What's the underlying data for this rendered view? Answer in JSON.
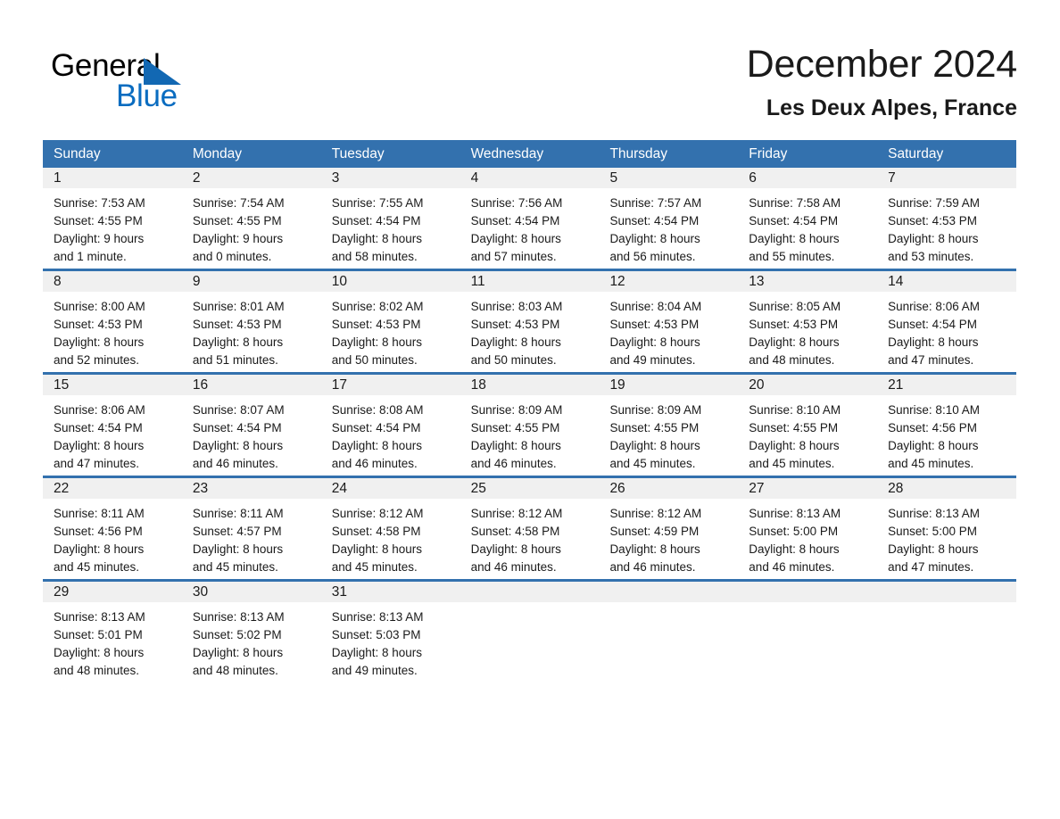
{
  "brand": {
    "name_part1": "General",
    "name_part2": "Blue",
    "triangle_color": "#1268b3",
    "blue_color": "#0a6cc0"
  },
  "header": {
    "title": "December 2024",
    "subtitle": "Les Deux Alpes, France"
  },
  "theme": {
    "header_blue": "#3371ae",
    "row_divider_blue": "#3371ae",
    "daynum_band_bg": "#f0f0f0",
    "text_color": "#1a1a1a"
  },
  "calendar": {
    "weekdays": [
      "Sunday",
      "Monday",
      "Tuesday",
      "Wednesday",
      "Thursday",
      "Friday",
      "Saturday"
    ],
    "weeks": [
      {
        "days": [
          {
            "num": "1",
            "sunrise": "Sunrise: 7:53 AM",
            "sunset": "Sunset: 4:55 PM",
            "daylight1": "Daylight: 9 hours",
            "daylight2": "and 1 minute."
          },
          {
            "num": "2",
            "sunrise": "Sunrise: 7:54 AM",
            "sunset": "Sunset: 4:55 PM",
            "daylight1": "Daylight: 9 hours",
            "daylight2": "and 0 minutes."
          },
          {
            "num": "3",
            "sunrise": "Sunrise: 7:55 AM",
            "sunset": "Sunset: 4:54 PM",
            "daylight1": "Daylight: 8 hours",
            "daylight2": "and 58 minutes."
          },
          {
            "num": "4",
            "sunrise": "Sunrise: 7:56 AM",
            "sunset": "Sunset: 4:54 PM",
            "daylight1": "Daylight: 8 hours",
            "daylight2": "and 57 minutes."
          },
          {
            "num": "5",
            "sunrise": "Sunrise: 7:57 AM",
            "sunset": "Sunset: 4:54 PM",
            "daylight1": "Daylight: 8 hours",
            "daylight2": "and 56 minutes."
          },
          {
            "num": "6",
            "sunrise": "Sunrise: 7:58 AM",
            "sunset": "Sunset: 4:54 PM",
            "daylight1": "Daylight: 8 hours",
            "daylight2": "and 55 minutes."
          },
          {
            "num": "7",
            "sunrise": "Sunrise: 7:59 AM",
            "sunset": "Sunset: 4:53 PM",
            "daylight1": "Daylight: 8 hours",
            "daylight2": "and 53 minutes."
          }
        ]
      },
      {
        "days": [
          {
            "num": "8",
            "sunrise": "Sunrise: 8:00 AM",
            "sunset": "Sunset: 4:53 PM",
            "daylight1": "Daylight: 8 hours",
            "daylight2": "and 52 minutes."
          },
          {
            "num": "9",
            "sunrise": "Sunrise: 8:01 AM",
            "sunset": "Sunset: 4:53 PM",
            "daylight1": "Daylight: 8 hours",
            "daylight2": "and 51 minutes."
          },
          {
            "num": "10",
            "sunrise": "Sunrise: 8:02 AM",
            "sunset": "Sunset: 4:53 PM",
            "daylight1": "Daylight: 8 hours",
            "daylight2": "and 50 minutes."
          },
          {
            "num": "11",
            "sunrise": "Sunrise: 8:03 AM",
            "sunset": "Sunset: 4:53 PM",
            "daylight1": "Daylight: 8 hours",
            "daylight2": "and 50 minutes."
          },
          {
            "num": "12",
            "sunrise": "Sunrise: 8:04 AM",
            "sunset": "Sunset: 4:53 PM",
            "daylight1": "Daylight: 8 hours",
            "daylight2": "and 49 minutes."
          },
          {
            "num": "13",
            "sunrise": "Sunrise: 8:05 AM",
            "sunset": "Sunset: 4:53 PM",
            "daylight1": "Daylight: 8 hours",
            "daylight2": "and 48 minutes."
          },
          {
            "num": "14",
            "sunrise": "Sunrise: 8:06 AM",
            "sunset": "Sunset: 4:54 PM",
            "daylight1": "Daylight: 8 hours",
            "daylight2": "and 47 minutes."
          }
        ]
      },
      {
        "days": [
          {
            "num": "15",
            "sunrise": "Sunrise: 8:06 AM",
            "sunset": "Sunset: 4:54 PM",
            "daylight1": "Daylight: 8 hours",
            "daylight2": "and 47 minutes."
          },
          {
            "num": "16",
            "sunrise": "Sunrise: 8:07 AM",
            "sunset": "Sunset: 4:54 PM",
            "daylight1": "Daylight: 8 hours",
            "daylight2": "and 46 minutes."
          },
          {
            "num": "17",
            "sunrise": "Sunrise: 8:08 AM",
            "sunset": "Sunset: 4:54 PM",
            "daylight1": "Daylight: 8 hours",
            "daylight2": "and 46 minutes."
          },
          {
            "num": "18",
            "sunrise": "Sunrise: 8:09 AM",
            "sunset": "Sunset: 4:55 PM",
            "daylight1": "Daylight: 8 hours",
            "daylight2": "and 46 minutes."
          },
          {
            "num": "19",
            "sunrise": "Sunrise: 8:09 AM",
            "sunset": "Sunset: 4:55 PM",
            "daylight1": "Daylight: 8 hours",
            "daylight2": "and 45 minutes."
          },
          {
            "num": "20",
            "sunrise": "Sunrise: 8:10 AM",
            "sunset": "Sunset: 4:55 PM",
            "daylight1": "Daylight: 8 hours",
            "daylight2": "and 45 minutes."
          },
          {
            "num": "21",
            "sunrise": "Sunrise: 8:10 AM",
            "sunset": "Sunset: 4:56 PM",
            "daylight1": "Daylight: 8 hours",
            "daylight2": "and 45 minutes."
          }
        ]
      },
      {
        "days": [
          {
            "num": "22",
            "sunrise": "Sunrise: 8:11 AM",
            "sunset": "Sunset: 4:56 PM",
            "daylight1": "Daylight: 8 hours",
            "daylight2": "and 45 minutes."
          },
          {
            "num": "23",
            "sunrise": "Sunrise: 8:11 AM",
            "sunset": "Sunset: 4:57 PM",
            "daylight1": "Daylight: 8 hours",
            "daylight2": "and 45 minutes."
          },
          {
            "num": "24",
            "sunrise": "Sunrise: 8:12 AM",
            "sunset": "Sunset: 4:58 PM",
            "daylight1": "Daylight: 8 hours",
            "daylight2": "and 45 minutes."
          },
          {
            "num": "25",
            "sunrise": "Sunrise: 8:12 AM",
            "sunset": "Sunset: 4:58 PM",
            "daylight1": "Daylight: 8 hours",
            "daylight2": "and 46 minutes."
          },
          {
            "num": "26",
            "sunrise": "Sunrise: 8:12 AM",
            "sunset": "Sunset: 4:59 PM",
            "daylight1": "Daylight: 8 hours",
            "daylight2": "and 46 minutes."
          },
          {
            "num": "27",
            "sunrise": "Sunrise: 8:13 AM",
            "sunset": "Sunset: 5:00 PM",
            "daylight1": "Daylight: 8 hours",
            "daylight2": "and 46 minutes."
          },
          {
            "num": "28",
            "sunrise": "Sunrise: 8:13 AM",
            "sunset": "Sunset: 5:00 PM",
            "daylight1": "Daylight: 8 hours",
            "daylight2": "and 47 minutes."
          }
        ]
      },
      {
        "days": [
          {
            "num": "29",
            "sunrise": "Sunrise: 8:13 AM",
            "sunset": "Sunset: 5:01 PM",
            "daylight1": "Daylight: 8 hours",
            "daylight2": "and 48 minutes."
          },
          {
            "num": "30",
            "sunrise": "Sunrise: 8:13 AM",
            "sunset": "Sunset: 5:02 PM",
            "daylight1": "Daylight: 8 hours",
            "daylight2": "and 48 minutes."
          },
          {
            "num": "31",
            "sunrise": "Sunrise: 8:13 AM",
            "sunset": "Sunset: 5:03 PM",
            "daylight1": "Daylight: 8 hours",
            "daylight2": "and 49 minutes."
          },
          {
            "num": "",
            "sunrise": "",
            "sunset": "",
            "daylight1": "",
            "daylight2": ""
          },
          {
            "num": "",
            "sunrise": "",
            "sunset": "",
            "daylight1": "",
            "daylight2": ""
          },
          {
            "num": "",
            "sunrise": "",
            "sunset": "",
            "daylight1": "",
            "daylight2": ""
          },
          {
            "num": "",
            "sunrise": "",
            "sunset": "",
            "daylight1": "",
            "daylight2": ""
          }
        ]
      }
    ]
  }
}
